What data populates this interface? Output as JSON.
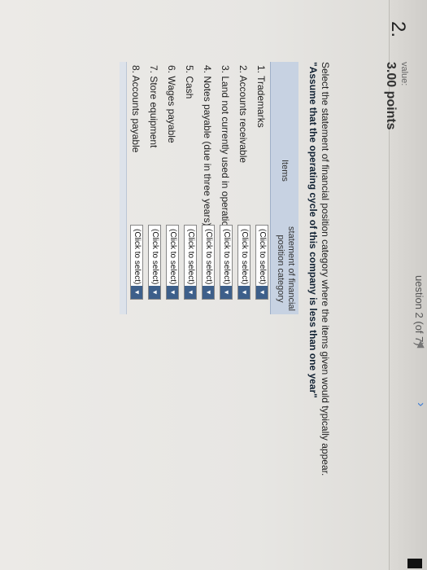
{
  "topbar": {
    "question_header": "uestion 2 (of 7)",
    "prev_icon": "triangle-left-icon",
    "next_icon": "chevron-right-icon",
    "bookmark_icon": "bookmark-icon"
  },
  "question": {
    "number": "2.",
    "value_label": "value:",
    "points": "3.00 points",
    "instruction": "Select the statement of financial position category where the items given would typically appear.",
    "assumption": "\"Assume that the operating cycle of this company is less than one year\""
  },
  "table": {
    "items_header": "Items",
    "category_header": "statement of financial position category",
    "rows": [
      {
        "label": "1. Trademarks",
        "selection": "(Click to select)"
      },
      {
        "label": "2. Accounts receivable",
        "selection": "(Click to select)"
      },
      {
        "label": "3. Land not currently used in operations",
        "selection": "(Click to select)"
      },
      {
        "label": "4. Notes payable (due in three years)",
        "selection": "(Click to select)"
      },
      {
        "label": "5. Cash",
        "selection": "(Click to select)"
      },
      {
        "label": "6. Wages payable",
        "selection": "(Click to select)"
      },
      {
        "label": "7. Store equipment",
        "selection": "(Click to select)"
      },
      {
        "label": "8. Accounts payable",
        "selection": "(Click to select)"
      }
    ]
  },
  "colors": {
    "header_bg": "#c7d2e2",
    "select_arrow": "#3d5f8a",
    "next_arrow": "#3a7bd5"
  }
}
